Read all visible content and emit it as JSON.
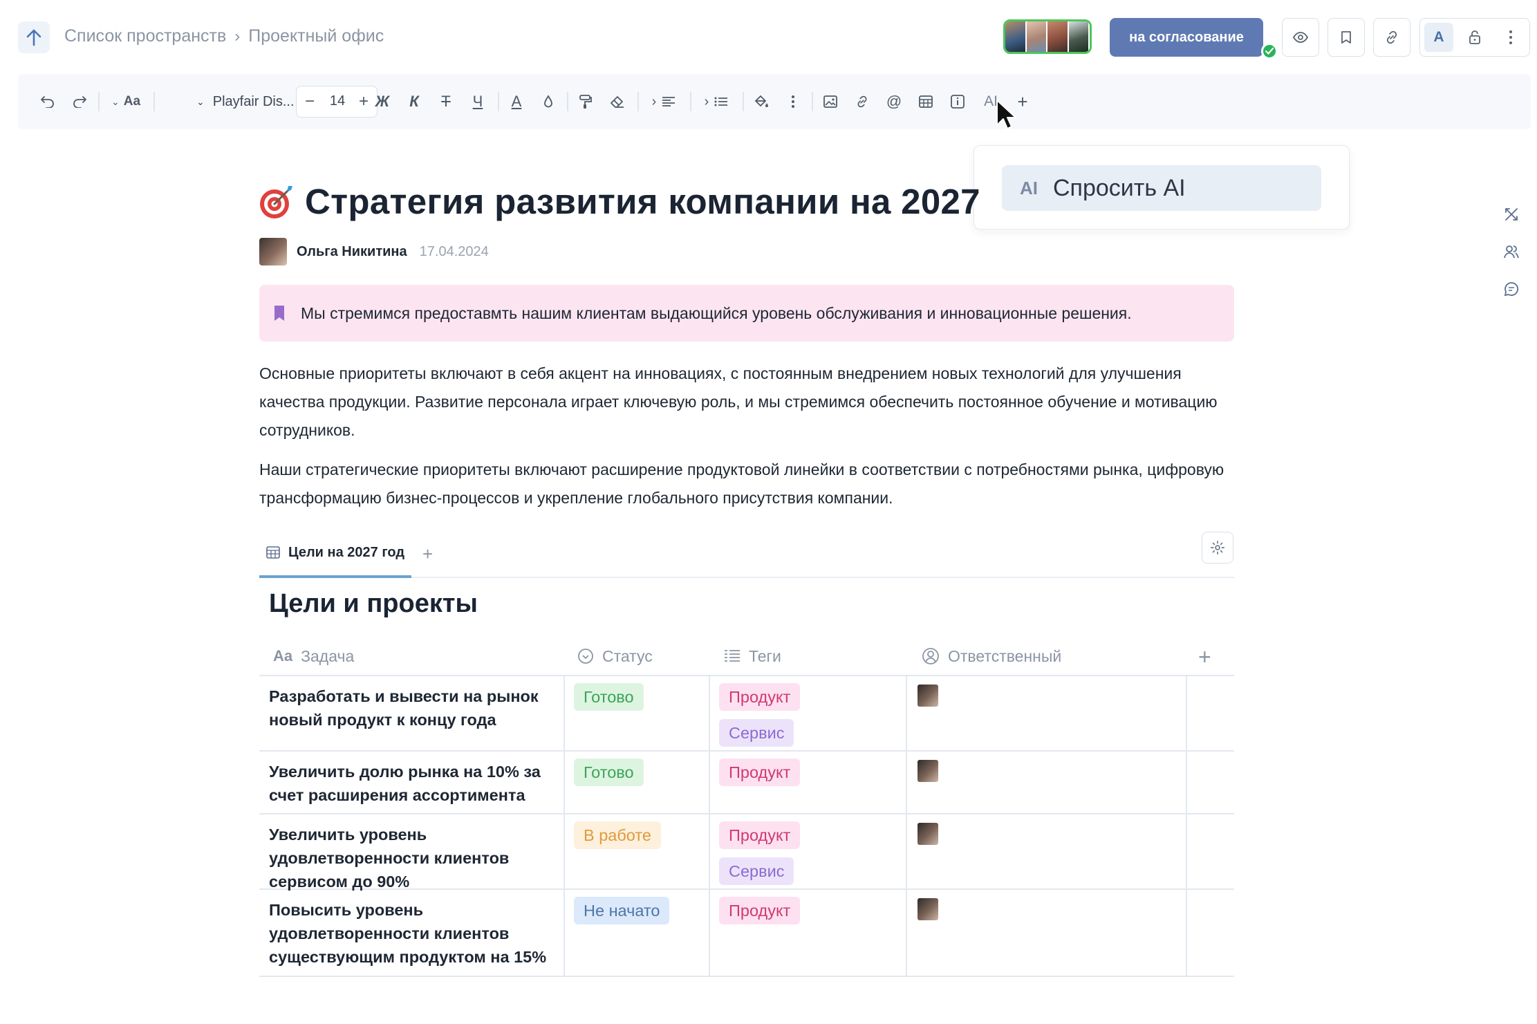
{
  "header": {
    "breadcrumb": [
      "Список пространств",
      "Проектный офис"
    ],
    "status_button": "на согласование",
    "format_toggle_label": "A"
  },
  "toolbar": {
    "font_family": "Playfair Dis...",
    "font_size": "14",
    "bold_label": "Ж",
    "italic_label": "К",
    "strike_label": "Т",
    "underline_label": "Ч",
    "text_color_label": "A",
    "style_label": "Aa",
    "ai_label": "AI",
    "add_label": "+"
  },
  "ai_menu": {
    "badge": "AI",
    "item": "Спросить AI"
  },
  "document": {
    "title": "Стратегия развития компании на 2027",
    "author": "Ольга Никитина",
    "date": "17.04.2024",
    "callout": "Мы стремимся предоставмть нашим клиентам выдающийся уровень обслуживания и инновационные решения.",
    "paragraphs": [
      "Основные приоритеты включают в себя акцент на инновациях, с постоянным внедрением новых технологий для улучшения качества продукции. Развитие персонала играет ключевую роль, и мы стремимся обеспечить постоянное обучение и мотивацию сотрудников.",
      "Наши стратегические приоритеты включают расширение продуктовой линейки в соответствии с потребностями рынка, цифровую трансформацию бизнес-процессов и укрепление глобального присутствия компании."
    ]
  },
  "database": {
    "tab": "Цели на 2027 год",
    "tab_add": "+",
    "title": "Цели и проекты",
    "columns": {
      "task": "Задача",
      "task_icon": "Aa",
      "status": "Статус",
      "tags": "Теги",
      "owner": "Ответственный",
      "add": "+"
    },
    "rows": [
      {
        "task": "Разработать и вывести на рынок новый продукт к концу года",
        "status": "Готово",
        "tags": [
          "Продукт",
          "Сервис"
        ]
      },
      {
        "task": "Увеличить долю рынка на 10% за счет расширения ассортимента",
        "status": "Готово",
        "tags": [
          "Продукт"
        ]
      },
      {
        "task": "Увеличить уровень удовлетворенности клиентов сервисом до 90%",
        "status": "В работе",
        "tags": [
          "Продукт",
          "Сервис"
        ]
      },
      {
        "task": "Повысить уровень удовлетворенности клиентов существующим продуктом на 15%",
        "status": "Не начато",
        "tags": [
          "Продукт"
        ]
      }
    ]
  },
  "colors": {
    "accent": "#5f7ab3",
    "callout_bg": "#fce4f1",
    "done": "#3aa458",
    "in_progress": "#e09a3c",
    "not_started": "#4c76a7",
    "tag_product": "#d0396f",
    "tag_service": "#8a6bd0"
  },
  "icons": [
    "arrow-up-icon",
    "chevron-right-icon",
    "eye-icon",
    "bookmark-icon",
    "link-icon",
    "lock-icon",
    "more-vertical-icon",
    "undo-icon",
    "redo-icon",
    "align-left-icon",
    "list-icon",
    "paint-bucket-icon",
    "image-icon",
    "mention-icon",
    "table-icon",
    "info-icon",
    "gear-icon",
    "target-icon"
  ]
}
